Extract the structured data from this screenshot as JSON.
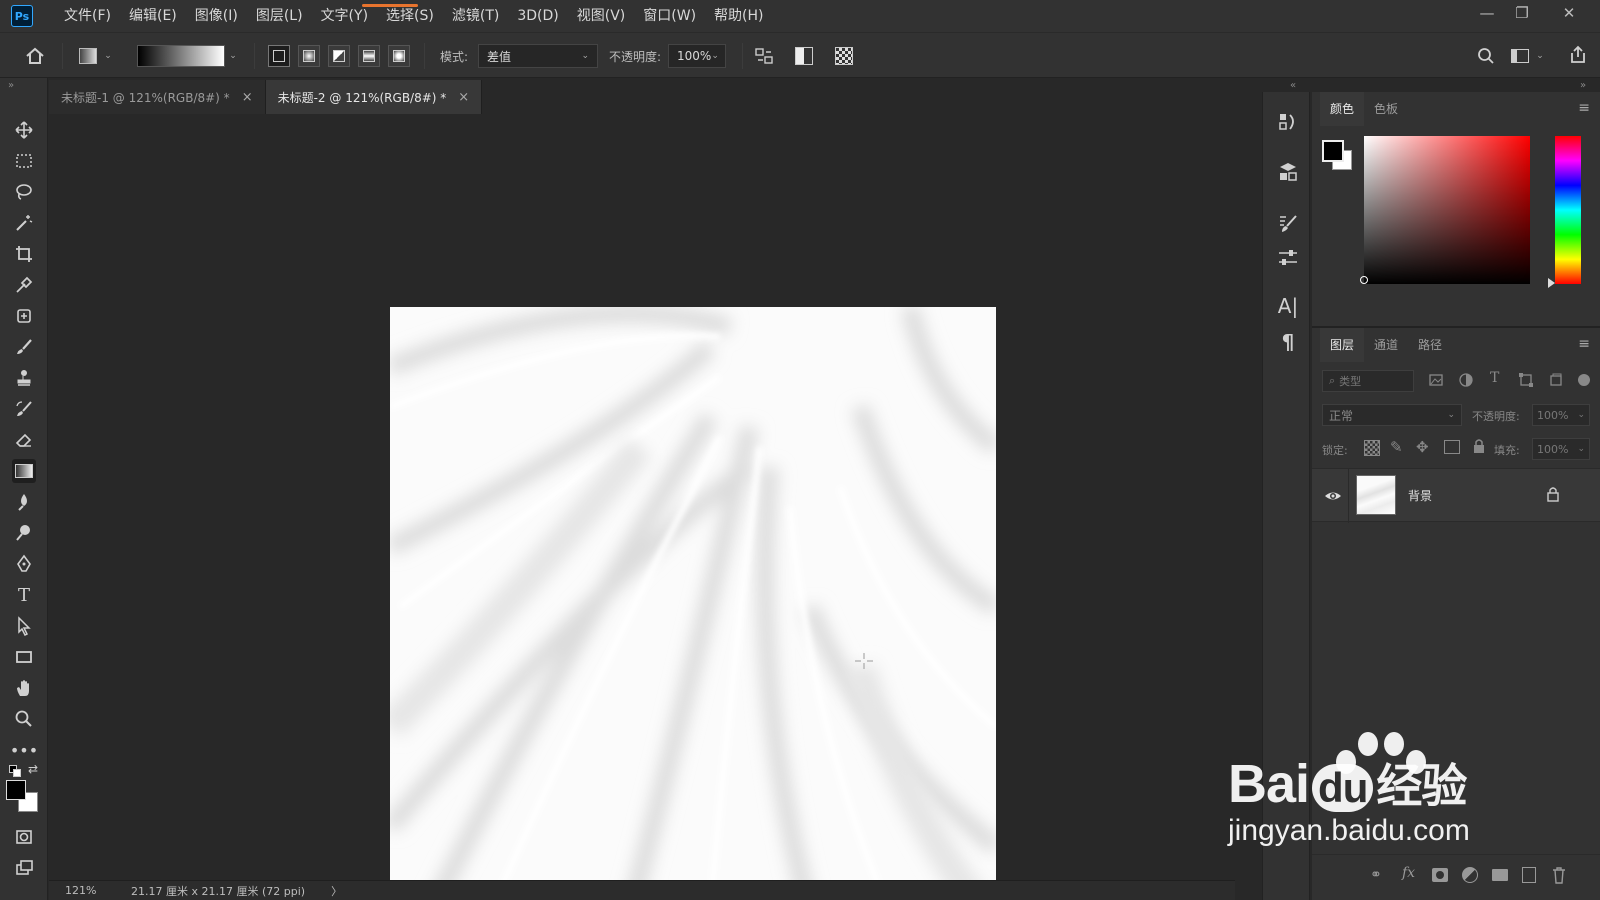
{
  "app": {
    "logo": "Ps"
  },
  "menu": [
    "文件(F)",
    "编辑(E)",
    "图像(I)",
    "图层(L)",
    "文字(Y)",
    "选择(S)",
    "滤镜(T)",
    "3D(D)",
    "视图(V)",
    "窗口(W)",
    "帮助(H)"
  ],
  "window_controls": {
    "minimize": "—",
    "restore": "❐",
    "close": "✕"
  },
  "options": {
    "mode_label": "模式:",
    "mode_value": "差值",
    "opacity_label": "不透明度:",
    "opacity_value": "100%"
  },
  "tabs": [
    {
      "label": "未标题-1 @ 121%(RGB/8#) *",
      "close": "×"
    },
    {
      "label": "未标题-2 @ 121%(RGB/8#) *",
      "close": "×"
    }
  ],
  "status": {
    "zoom": "121%",
    "doc_size": "21.17 厘米 x 21.17 厘米 (72 ppi)",
    "arrow": "〉"
  },
  "color_panel": {
    "tabs": [
      "颜色",
      "色板"
    ],
    "foreground": "#000000",
    "background": "#ffffff",
    "hue_color": "#ff0000"
  },
  "layers_panel": {
    "tabs": [
      "图层",
      "通道",
      "路径"
    ],
    "filter_placeholder": "类型",
    "blend_mode": "正常",
    "opacity_label": "不透明度:",
    "opacity_value": "100%",
    "lock_label": "锁定:",
    "fill_label": "填充:",
    "fill_value": "100%",
    "layers": [
      {
        "name": "背景",
        "visible": true,
        "locked": true
      }
    ]
  },
  "watermark": {
    "brand": "Bai",
    "brand2": "du",
    "cn": "经验",
    "url": "jingyan.baidu.com"
  }
}
